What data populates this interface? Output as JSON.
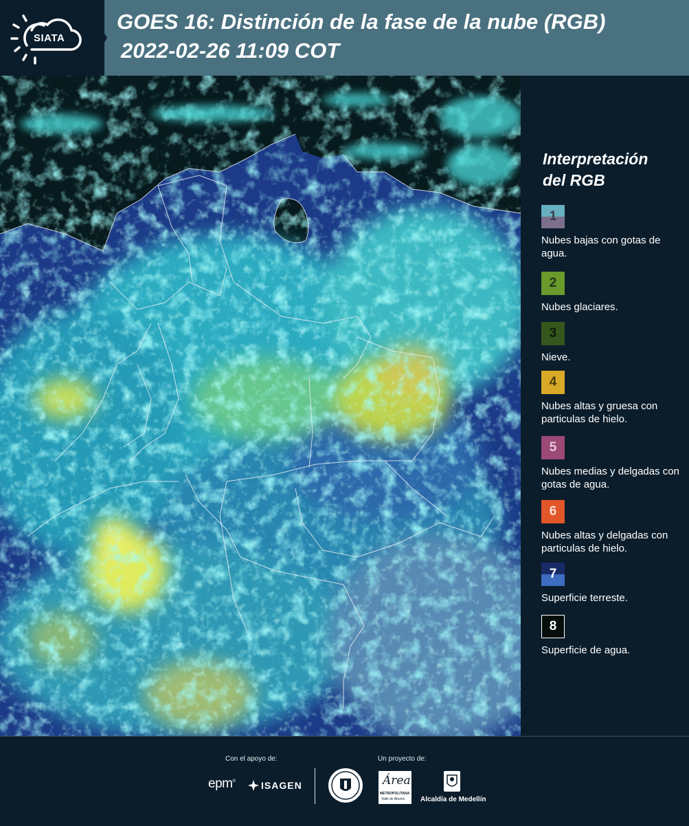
{
  "header": {
    "logo_text": "SIATA",
    "title_line1": "GOES 16: Distinción de la fase de la nube (RGB)",
    "title_line2": "2022-02-26 11:09 COT"
  },
  "legend": {
    "title_line1": "Interpretación",
    "title_line2": "del RGB",
    "items": [
      {
        "number": "1",
        "label": "Nubes bajas con gotas de agua.",
        "color_top": "#66b0bf",
        "color_bottom": "#7c6f8c"
      },
      {
        "number": "2",
        "label": "Nubes glaciares.",
        "color": "#6a9a2c"
      },
      {
        "number": "3",
        "label": "Nieve.",
        "color": "#35571e"
      },
      {
        "number": "4",
        "label": "Nubes altas y gruesa con particulas de hielo.",
        "color": "#d9aa27"
      },
      {
        "number": "5",
        "label": "Nubes medias y delgadas con gotas de agua.",
        "color": "#9a4a74"
      },
      {
        "number": "6",
        "label": "Nubes altas y delgadas con particulas de hielo.",
        "color": "#e2562a"
      },
      {
        "number": "7",
        "label": "Superficie terreste.",
        "color_top": "#182a66",
        "color_bottom": "#3d6cc0"
      },
      {
        "number": "8",
        "label": "Superficie de agua.",
        "color": "#050d0d"
      }
    ]
  },
  "footer": {
    "support_label": "Con el apoyo de:",
    "project_label": "Un proyecto de:",
    "sponsor_epm": "epm",
    "sponsor_isagen": "ISAGEN",
    "area_logo_text": "Área",
    "area_sub1": "METROPOLITANA",
    "area_sub2": "Valle de Aburrá",
    "alcaldia_label": "Alcaldía de Medellín"
  },
  "colors": {
    "header_bg": "#4a7180",
    "panel_bg": "#0b1d2b",
    "ocean": "#071a1d",
    "land": "#1f3d8c",
    "cloud_cyan": "#3ecfd6",
    "cloud_yellow": "#e3e64a"
  }
}
